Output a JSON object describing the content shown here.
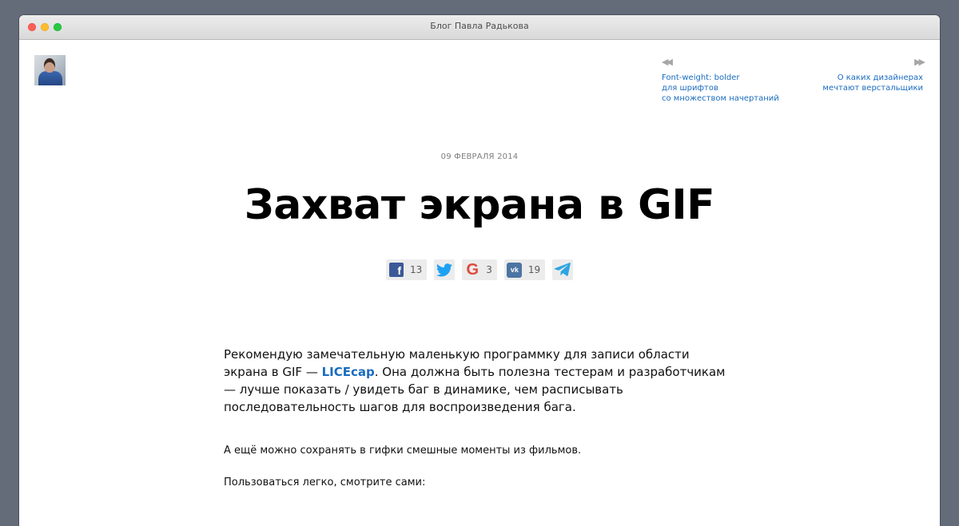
{
  "window": {
    "title": "Блог Павла Радькова"
  },
  "header": {
    "avatar_alt": "avatar",
    "prev": {
      "arrow": "◀◀",
      "lines": [
        "Font-weight: bolder",
        "для шрифтов",
        "со множеством начертаний"
      ]
    },
    "next": {
      "arrow": "▶▶",
      "lines": [
        "О каких дизайнерах",
        "мечтают верстальщики"
      ]
    }
  },
  "post": {
    "date": "09 ФЕВРАЛЯ 2014",
    "title": "Захват экрана в GIF",
    "share": {
      "facebook_count": "13",
      "google_count": "3",
      "vk_count": "19"
    },
    "paragraph1_before": "Рекомендую замечательную маленькую программку для записи области экрана в GIF — ",
    "paragraph1_link": "LICEcap",
    "paragraph1_after": ". Она должна быть полезна тестерам и разработчикам — лучше показать / увидеть баг в динамике, чем расписывать последовательность шагов для воспроизведения бага.",
    "paragraph2": "А ещё можно сохранять в гифки смешные моменты из фильмов.",
    "paragraph3": "Пользоваться легко, смотрите сами:"
  },
  "colors": {
    "link": "#1a6cbf",
    "facebook": "#3b5998",
    "twitter": "#1da1f2",
    "google": "#dc4b3e",
    "vk": "#4c75a3",
    "telegram": "#2ca5e0"
  },
  "icons": {
    "facebook": "facebook-icon",
    "twitter": "twitter-icon",
    "google": "google-icon",
    "vk": "vk-icon",
    "telegram": "telegram-icon"
  }
}
